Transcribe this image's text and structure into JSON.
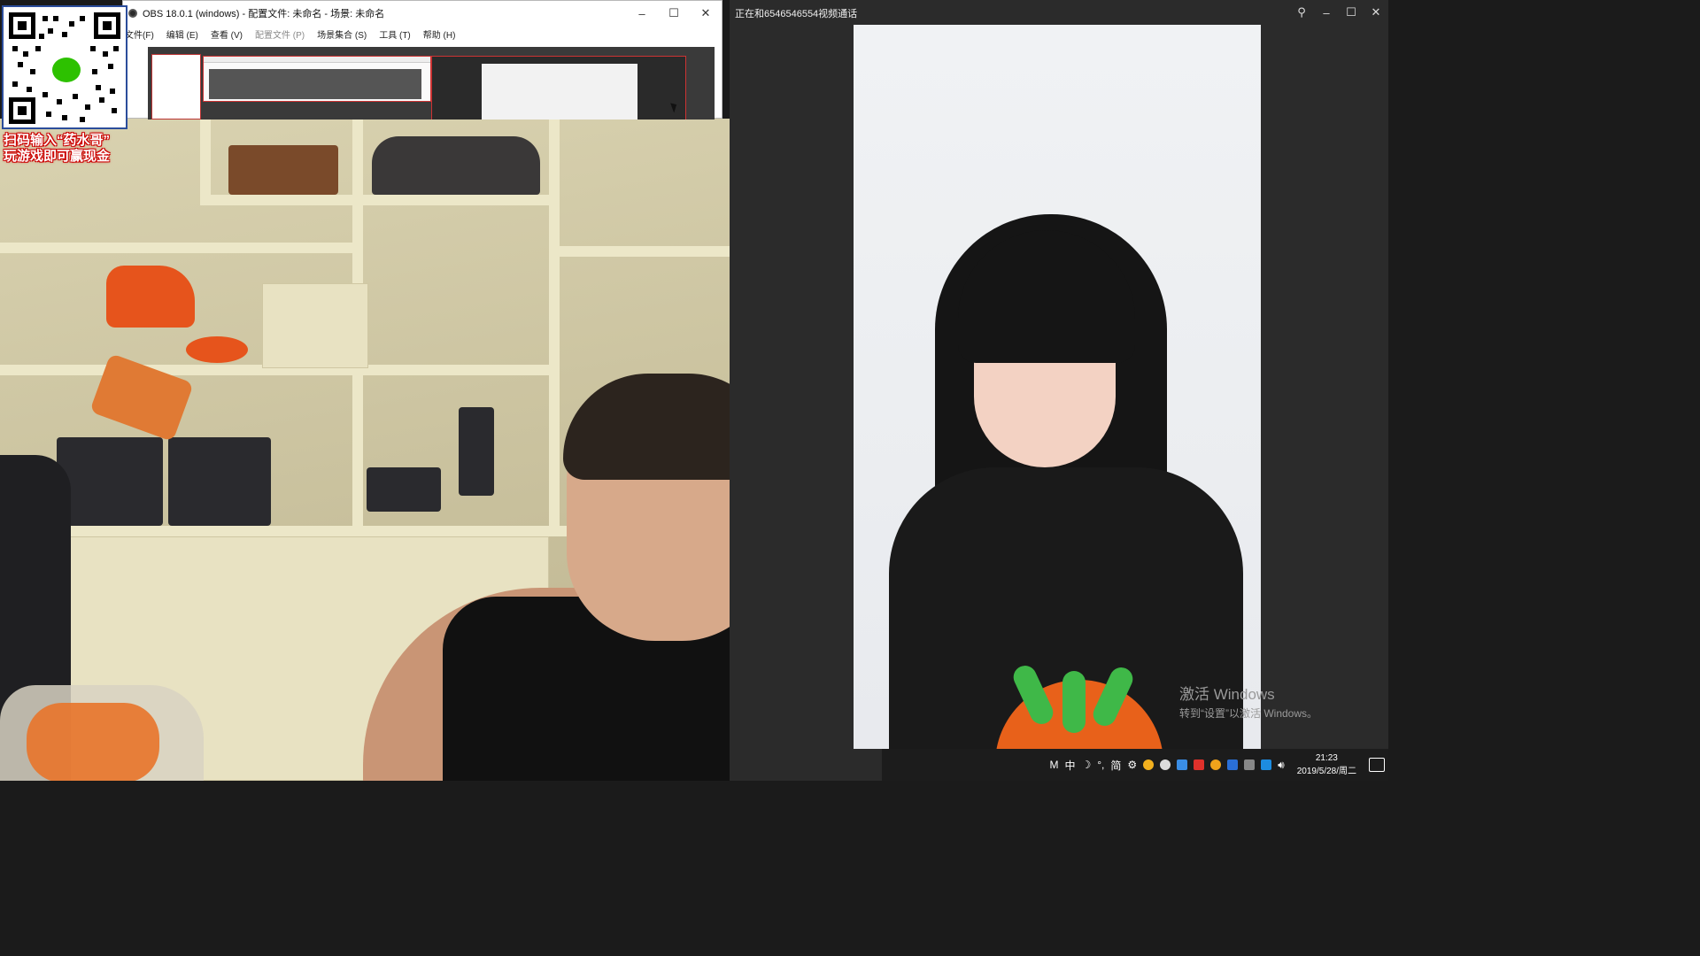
{
  "qr_overlay": {
    "line1": "扫码输入“药水哥”",
    "line2": "玩游戏即可赢现金"
  },
  "obs_window": {
    "title": "OBS 18.0.1 (windows) - 配置文件: 未命名 - 场景: 未命名",
    "menu": [
      {
        "label": "文件(F)",
        "disabled": false
      },
      {
        "label": "编辑 (E)",
        "disabled": false
      },
      {
        "label": "查看 (V)",
        "disabled": false
      },
      {
        "label": "配置文件 (P)",
        "disabled": true
      },
      {
        "label": "场景集合 (S)",
        "disabled": false
      },
      {
        "label": "工具 (T)",
        "disabled": false
      },
      {
        "label": "帮助 (H)",
        "disabled": false
      }
    ],
    "controls": {
      "minimize": "–",
      "maximize": "☐",
      "close": "✕"
    }
  },
  "call_window": {
    "title": "正在和6546546554视频通话",
    "controls": {
      "pin": "⚲",
      "minimize": "–",
      "maximize": "☐",
      "close": "✕"
    }
  },
  "watermark": {
    "line1": "激活 Windows",
    "line2": "转到“设置”以激活 Windows。"
  },
  "taskbar": {
    "tray_text": [
      "M",
      "中",
      "☽",
      "°,",
      "简",
      "⚙"
    ],
    "time": "21:23",
    "date": "2019/5/28/周二"
  }
}
